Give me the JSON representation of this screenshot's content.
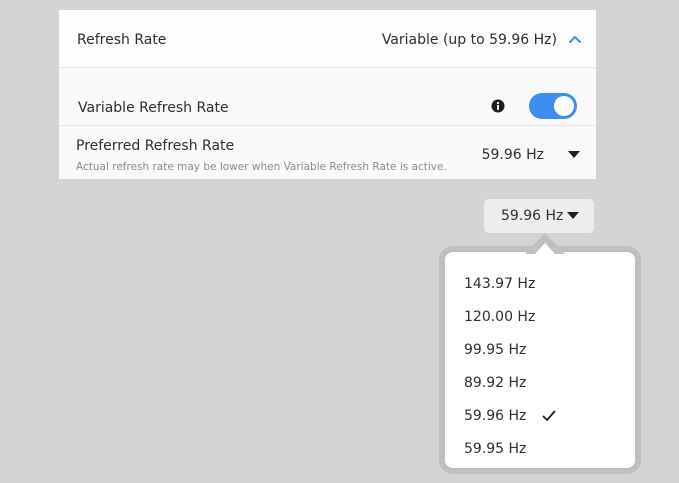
{
  "refresh_rate": {
    "label": "Refresh Rate",
    "value": "Variable (up to 59.96 Hz)",
    "expand_icon": "chevron-up-icon"
  },
  "vrr": {
    "label": "Variable Refresh Rate",
    "info_icon": "info-icon",
    "enabled": true,
    "accent_color": "#3d8ef0"
  },
  "preferred": {
    "label": "Preferred Refresh Rate",
    "subtitle": "Actual refresh rate may be lower when Variable Refresh Rate is active.",
    "value": "59.96 Hz"
  },
  "dropdown": {
    "button_label": "59.96 Hz",
    "options": [
      {
        "label": "143.97 Hz",
        "selected": false
      },
      {
        "label": "120.00 Hz",
        "selected": false
      },
      {
        "label": "99.95 Hz",
        "selected": false
      },
      {
        "label": "89.92 Hz",
        "selected": false
      },
      {
        "label": "59.96 Hz",
        "selected": true
      },
      {
        "label": "59.95 Hz",
        "selected": false
      }
    ]
  }
}
